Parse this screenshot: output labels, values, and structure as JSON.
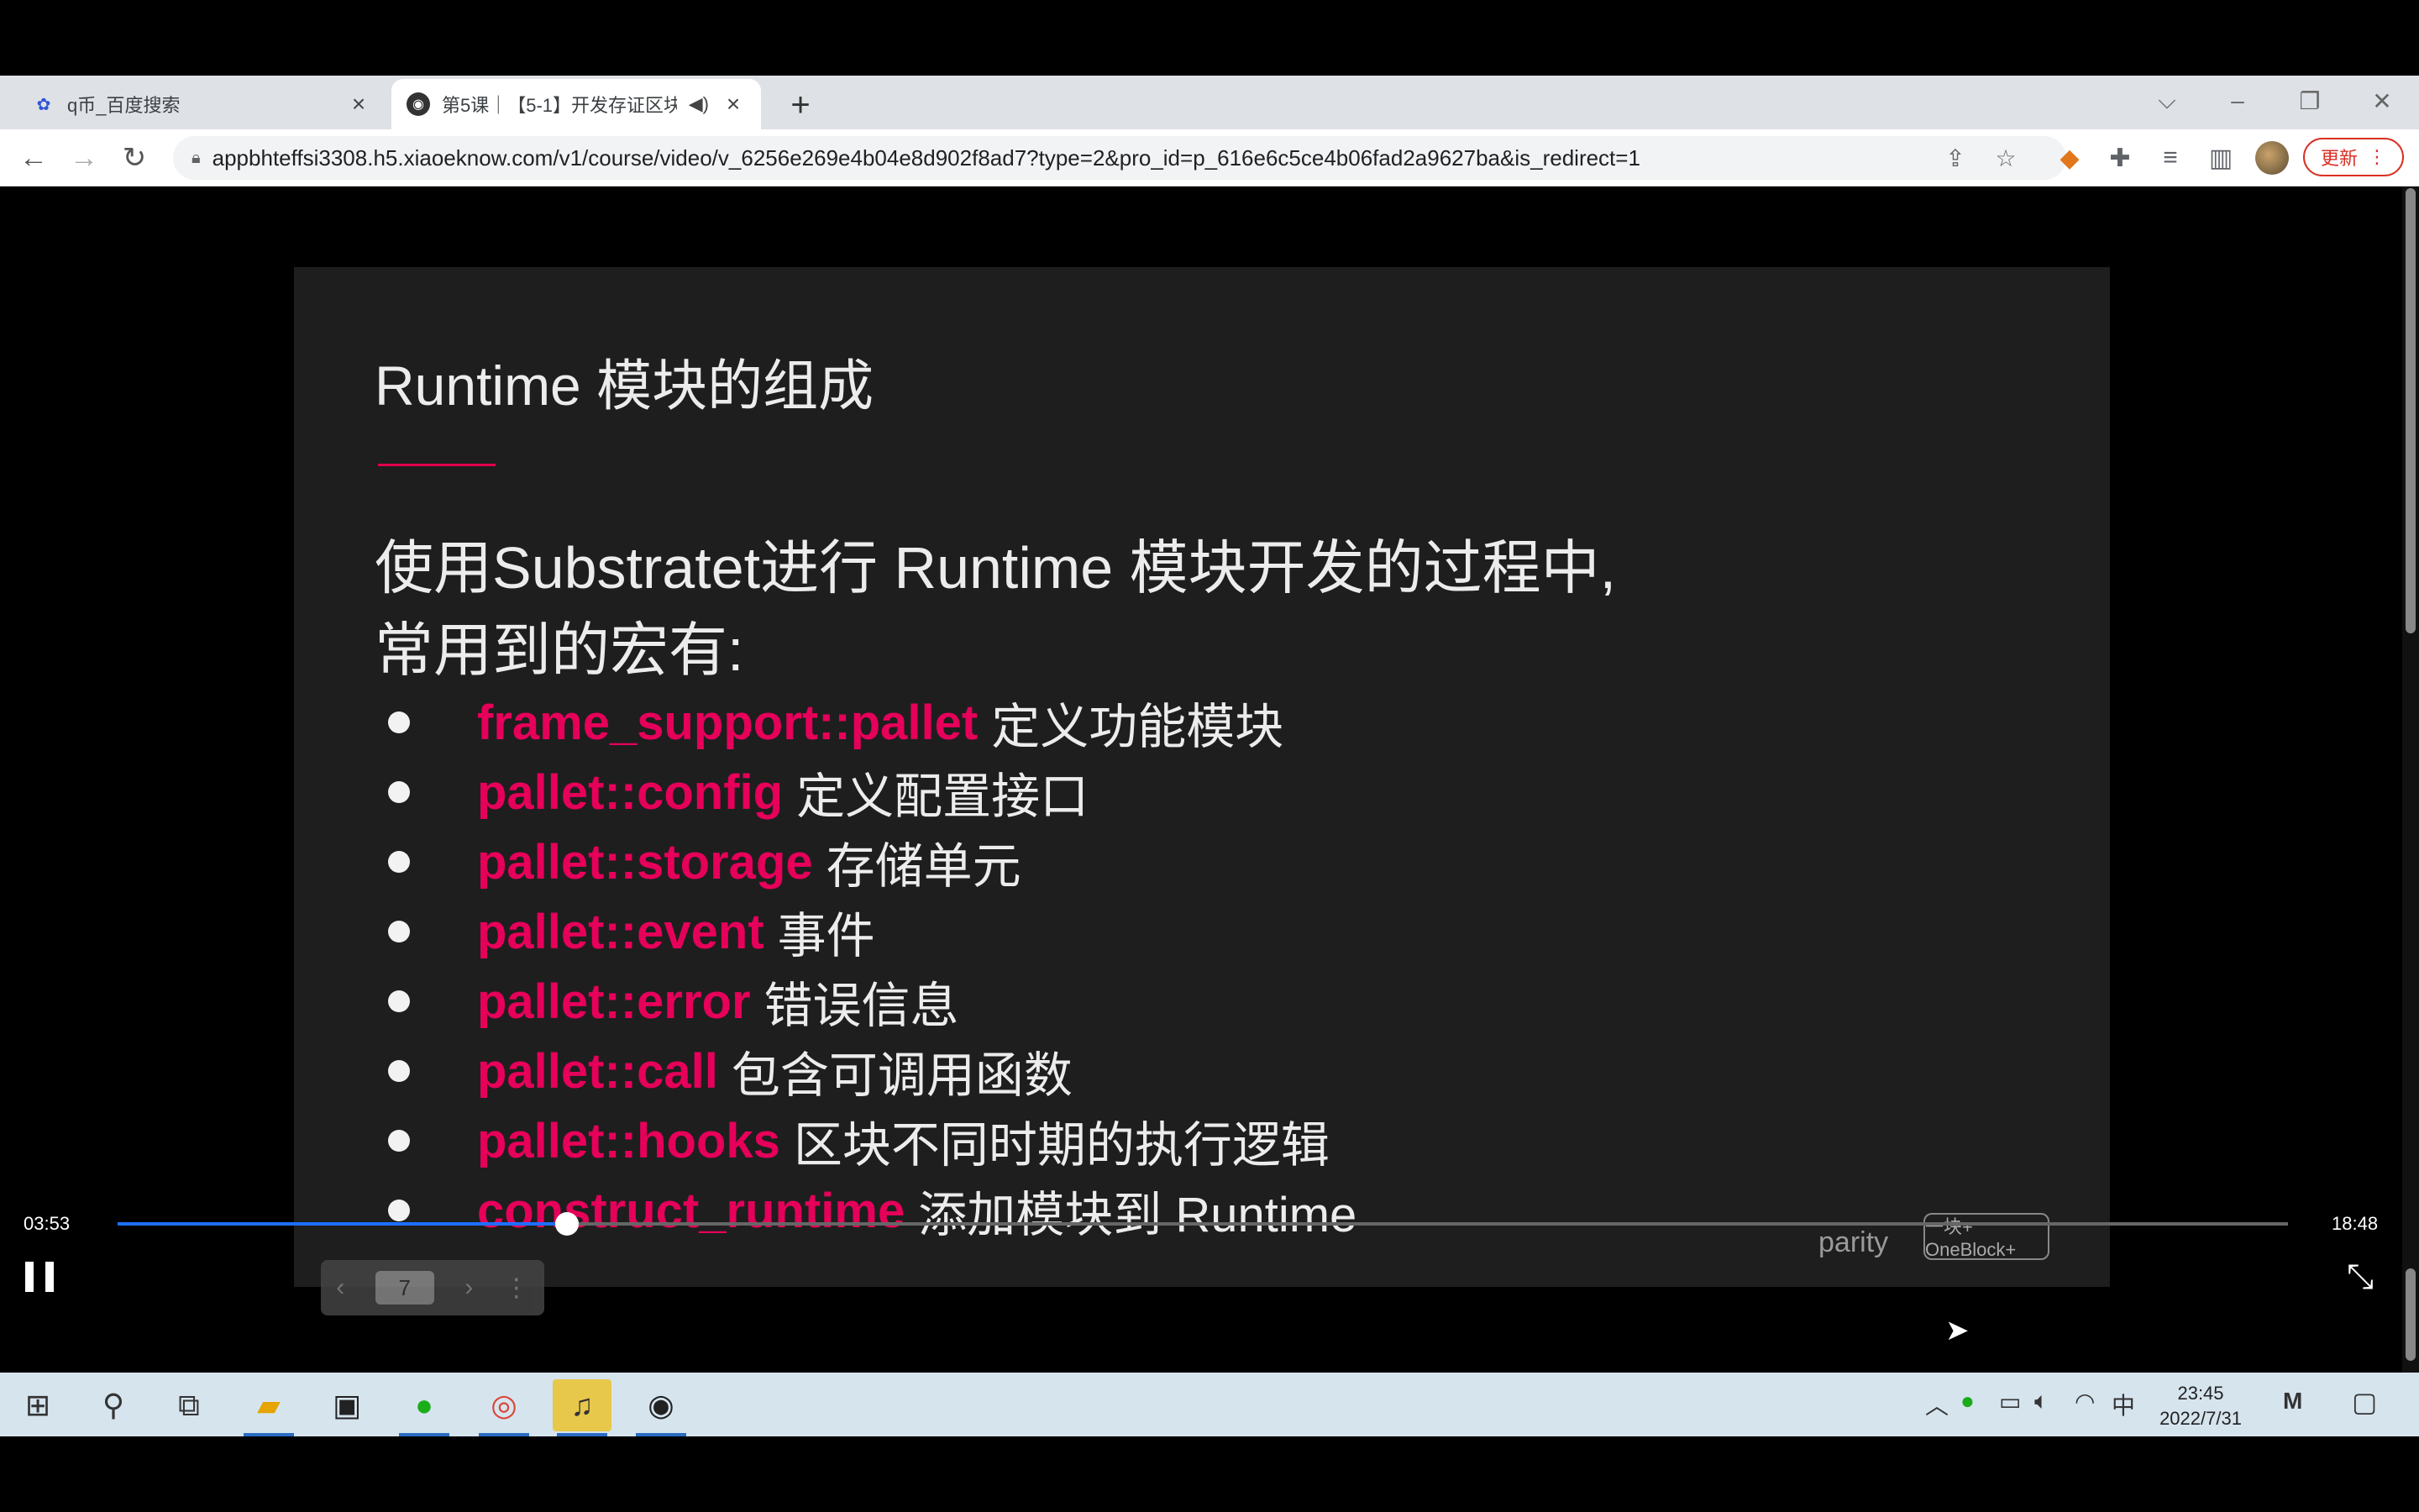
{
  "browser": {
    "tabs": [
      {
        "title": "q币_百度搜索",
        "icon": "baidu-paw-icon"
      },
      {
        "title": "第5课｜【5-1】开发存证区块",
        "icon": "globe-icon"
      }
    ],
    "address": {
      "url": "appbhteffsi3308.h5.xiaoeknow.com/v1/course/video/v_6256e269e4b04e8d902f8ad7?type=2&pro_id=p_616e6c5ce4b06fad2a9627ba&is_redirect=1"
    },
    "update_label": "更新"
  },
  "slide": {
    "title": "Runtime 模块的组成",
    "intro_line1": "使用Substratet进行 Runtime 模块开发的过程中,",
    "intro_line2": "常用到的宏有:",
    "bullets": [
      {
        "macro": "frame_support::pallet",
        "desc": "定义功能模块"
      },
      {
        "macro": "pallet::config",
        "desc": "定义配置接口"
      },
      {
        "macro": "pallet::storage",
        "desc": "存储单元"
      },
      {
        "macro": "pallet::event",
        "desc": "事件"
      },
      {
        "macro": "pallet::error",
        "desc": "错误信息"
      },
      {
        "macro": "pallet::call",
        "desc": "包含可调用函数"
      },
      {
        "macro": "pallet::hooks",
        "desc": "区块不同时期的执行逻辑"
      },
      {
        "macro": "construct_runtime",
        "desc": "添加模块到 Runtime"
      }
    ],
    "logo_parity": "parity",
    "logo_oneblock": "一块+ OneBlock+",
    "page_number": "7"
  },
  "player": {
    "current_time": "03:53",
    "total_time": "18:48",
    "progress_fraction": 0.207
  },
  "taskbar": {
    "ime": "中",
    "time": "23:45",
    "date": "2022/7/31"
  },
  "colors": {
    "macro": "#e6005a",
    "progress": "#1e6fff",
    "accent_rule": "#e0004d"
  }
}
